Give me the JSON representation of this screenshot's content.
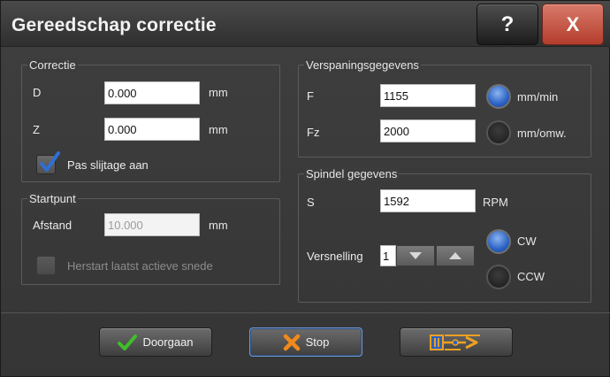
{
  "window": {
    "title": "Gereedschap correctie",
    "help_label": "?",
    "close_label": "X"
  },
  "correctie": {
    "legend": "Correctie",
    "d_label": "D",
    "d_value": "0.000",
    "d_unit": "mm",
    "z_label": "Z",
    "z_value": "0.000",
    "z_unit": "mm",
    "wear_label": "Pas slijtage aan",
    "wear_checked": true
  },
  "startpunt": {
    "legend": "Startpunt",
    "afstand_label": "Afstand",
    "afstand_value": "10.000",
    "afstand_unit": "mm",
    "restart_label": "Herstart laatst actieve snede",
    "restart_checked": false
  },
  "verspaning": {
    "legend": "Verspaningsgegevens",
    "f_label": "F",
    "f_value": "1155",
    "fz_label": "Fz",
    "fz_value": "2000",
    "unit_options": [
      "mm/min",
      "mm/omw."
    ],
    "unit_selected": "mm/min"
  },
  "spindel": {
    "legend": "Spindel gegevens",
    "s_label": "S",
    "s_value": "1592",
    "s_unit": "RPM",
    "versnelling_label": "Versnelling",
    "versnelling_value": "1",
    "direction_options": [
      "CW",
      "CCW"
    ],
    "direction_selected": "CW"
  },
  "footer": {
    "continue_label": "Doorgaan",
    "stop_label": "Stop"
  },
  "colors": {
    "accent_blue": "#2b62c4",
    "close_red": "#b43d2c",
    "check_green": "#3fbf2a",
    "stop_orange": "#f08a1c",
    "check_blue": "#2f6fd6"
  }
}
